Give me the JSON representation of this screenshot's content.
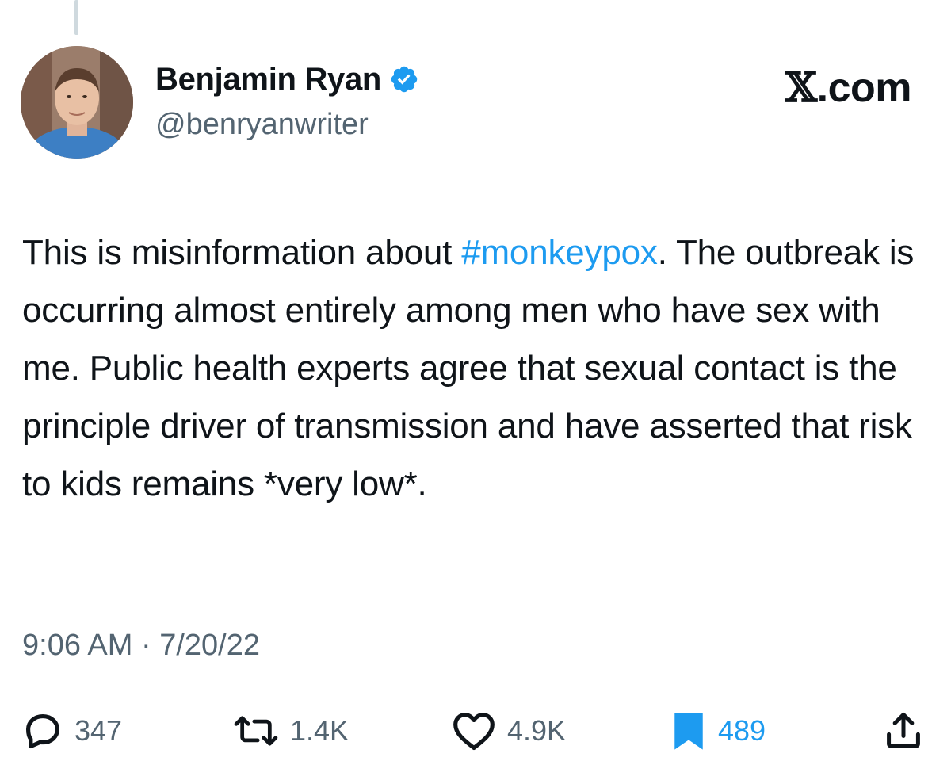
{
  "tweet": {
    "author": {
      "display_name": "Benjamin Ryan",
      "handle": "@benryanwriter",
      "verified": true
    },
    "site_label": ".com",
    "site_mark": "𝕏",
    "text_before": "This is misinformation about ",
    "hashtag": "#monkeypox",
    "text_after": ". The outbreak is occurring almost entirely among men who have sex with me. Public health experts agree that sexual contact is the principle driver of transmission and have asserted that risk to kids remains *very low*.",
    "timestamp": "9:06 AM · 7/20/22"
  },
  "actions": {
    "replies": "347",
    "reposts": "1.4K",
    "likes": "4.9K",
    "bookmarks": "489"
  },
  "icons": {
    "reply": "reply-icon",
    "repost": "repost-icon",
    "like": "heart-icon",
    "bookmark": "bookmark-icon",
    "share": "share-icon",
    "verified": "verified-badge-icon"
  },
  "colors": {
    "accent": "#1d9bf0",
    "secondary_text": "#536471",
    "primary_text": "#0f1419"
  }
}
